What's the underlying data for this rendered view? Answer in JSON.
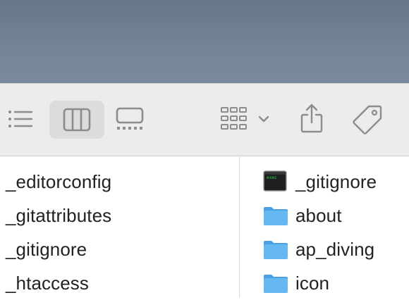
{
  "toolbar": {
    "buttons": [
      {
        "name": "list-view",
        "icon": "list-icon"
      },
      {
        "name": "column-view",
        "icon": "columns-icon",
        "selected": true
      },
      {
        "name": "gallery-view",
        "icon": "gallery-icon"
      },
      {
        "name": "group",
        "icon": "grid-icon"
      },
      {
        "name": "share",
        "icon": "share-icon"
      },
      {
        "name": "tags",
        "icon": "tag-icon"
      }
    ]
  },
  "columns": {
    "left": {
      "items": [
        {
          "label": "_editorconfig"
        },
        {
          "label": "_gitattributes"
        },
        {
          "label": "_gitignore"
        },
        {
          "label": "_htaccess"
        }
      ]
    },
    "right": {
      "items": [
        {
          "label": "_gitignore",
          "icon": "terminal-file-icon"
        },
        {
          "label": "about",
          "icon": "folder-icon"
        },
        {
          "label": "ap_diving",
          "icon": "folder-icon"
        },
        {
          "label": "icon",
          "icon": "folder-icon"
        }
      ],
      "terminal_badge": "exec"
    }
  },
  "colors": {
    "desktop": "#6f8193",
    "toolbar": "#ececec",
    "icon_gray": "#8c8c8c",
    "folder": "#5ab0ec",
    "text": "#222222"
  }
}
